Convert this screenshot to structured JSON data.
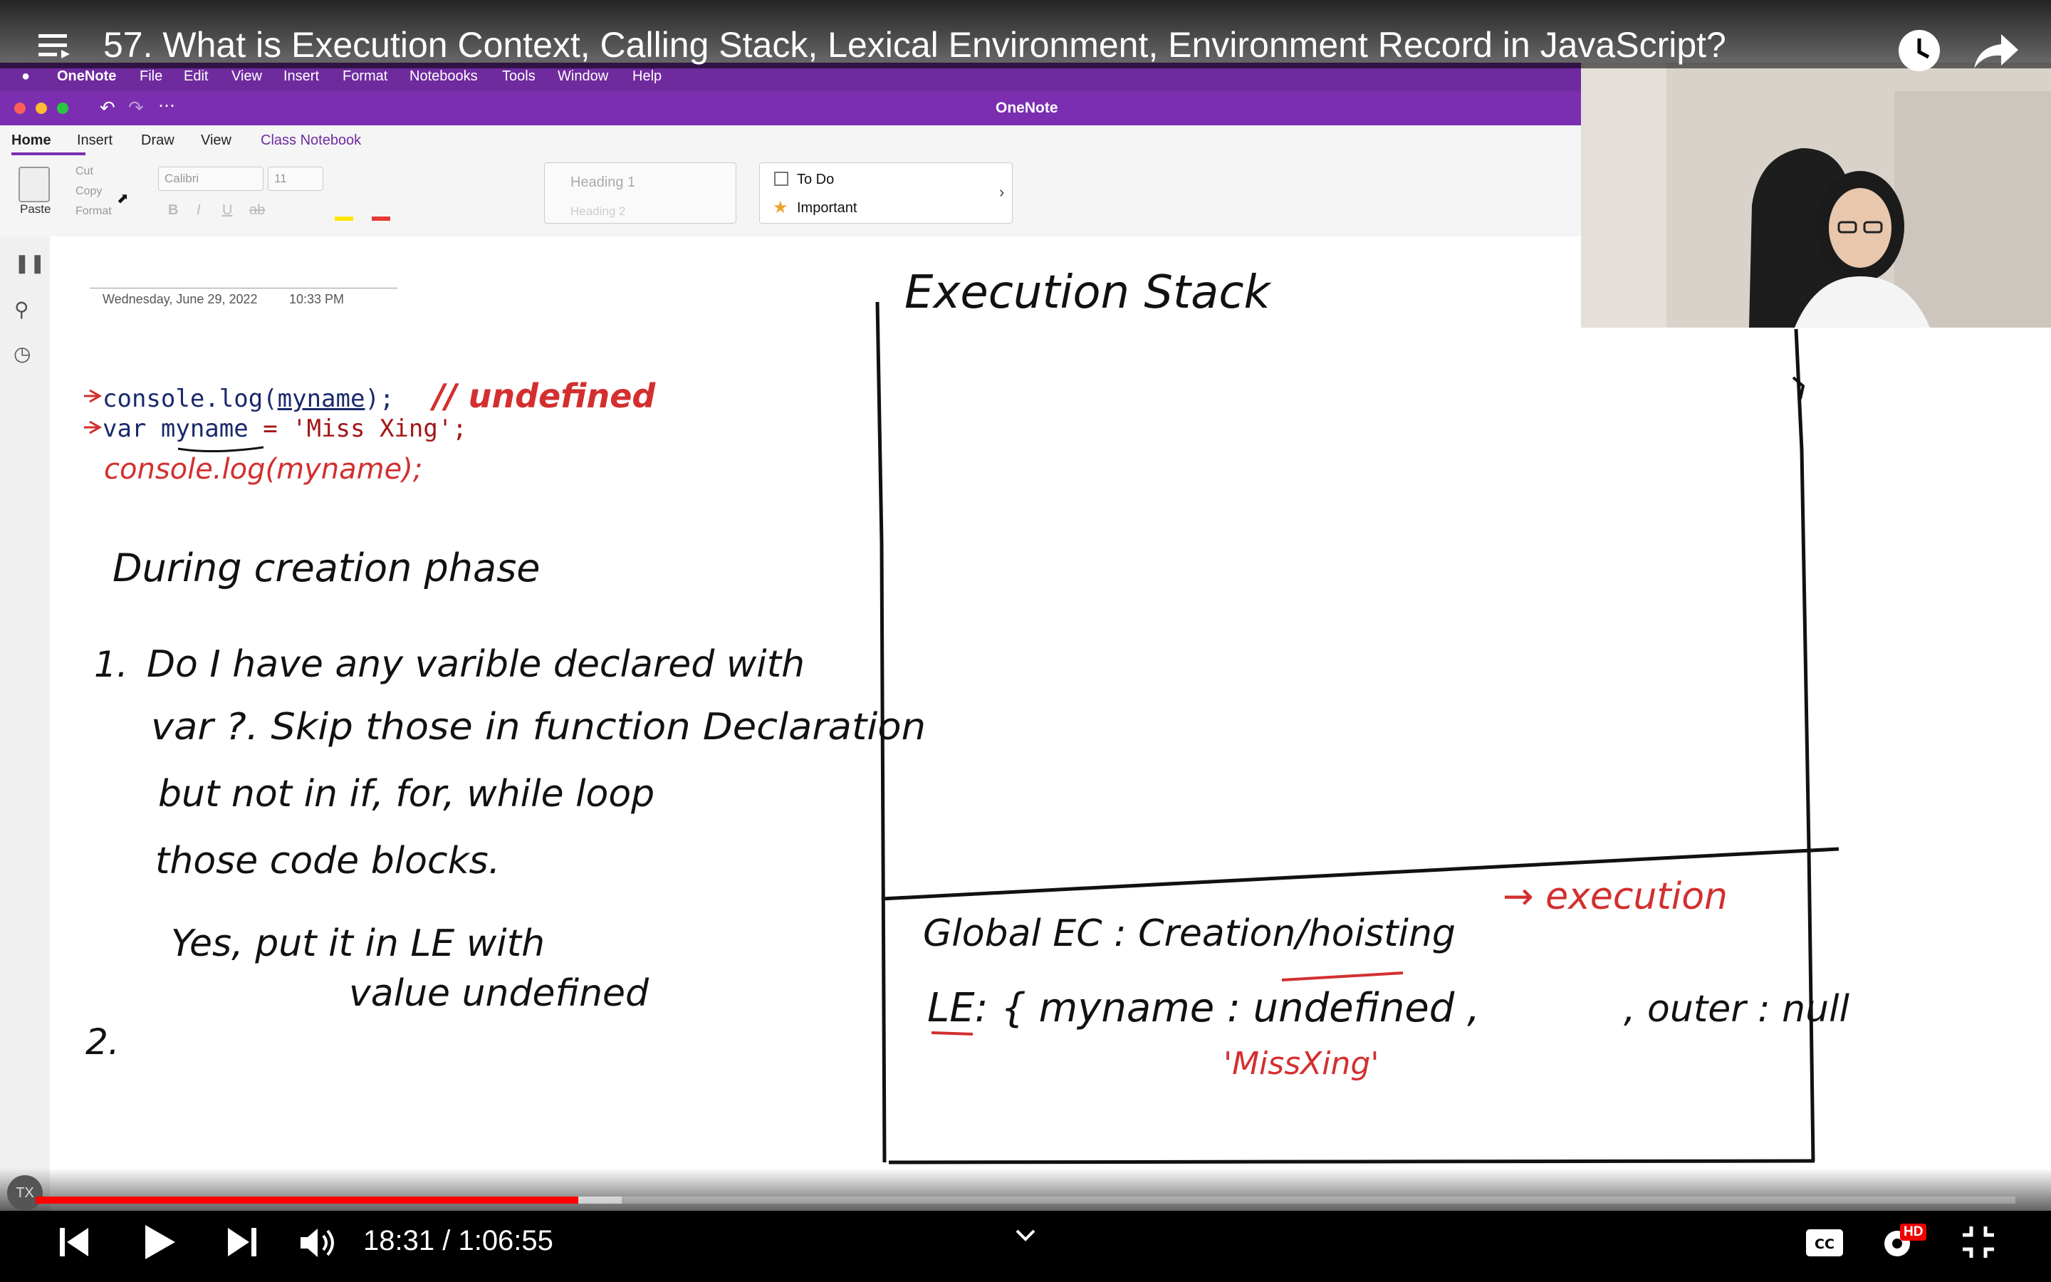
{
  "video": {
    "title": "57. What is Execution Context, Calling Stack, Lexical Environment, Environment Record in JavaScript?",
    "current_time": "18:31",
    "time_separator": " / ",
    "duration": "1:06:55",
    "progress_played": 0.274,
    "progress_buffered": 0.296,
    "hd_badge": "HD",
    "avatar_initials": "TX"
  },
  "mac_menu": {
    "app": "OneNote",
    "items": [
      "File",
      "Edit",
      "View",
      "Insert",
      "Format",
      "Notebooks",
      "Tools",
      "Window",
      "Help"
    ]
  },
  "onenote": {
    "window_title": "OneNote",
    "tabs": [
      "Home",
      "Insert",
      "Draw",
      "View",
      "Class Notebook"
    ],
    "active_tab": "Home",
    "ribbon": {
      "paste": "Paste",
      "cut": "Cut",
      "copy": "Copy",
      "format": "Format",
      "font": "Calibri",
      "size": "11",
      "style_heading1": "Heading 1",
      "style_heading2": "Heading 2",
      "tag_todo": "To Do",
      "tag_important": "Important"
    },
    "page_date": "Wednesday, June 29, 2022",
    "page_time": "10:33 PM"
  },
  "code_lines": [
    {
      "prefix": "console.log(",
      "var": "myname",
      "suffix": ");"
    },
    {
      "prefix": "var  ",
      "var": "myname",
      "suffix": " = 'Miss Xing';"
    }
  ],
  "ink": {
    "comment_undefined": "// undefined",
    "red_console_log": "console.log(myname);",
    "creation_phase": "During creation phase",
    "item1_num": "1.",
    "item1_line1": "Do I have any varible declared with",
    "item1_line2": "var ?. Skip those in function Declaration",
    "item1_line3": "but not in if, for, while loop",
    "item1_line4": "those code blocks.",
    "item1_line5": "Yes,   put it  in LE with",
    "item1_line6": "value undefined",
    "item2_num": "2.",
    "stack_title": "Execution Stack",
    "global_ec": "Global EC : Creation/hoisting",
    "arrow_execution": "→ execution",
    "le_line": "LE: { myname : undefined ,",
    "outer": ", outer : null",
    "missxing": "'MissXing'"
  },
  "colors": {
    "accent_red": "#e53935",
    "ink_black": "#111111",
    "ink_red": "#d32f2f",
    "onenote_purple": "#7b2fb0",
    "code_blue": "#1a2a6c"
  }
}
